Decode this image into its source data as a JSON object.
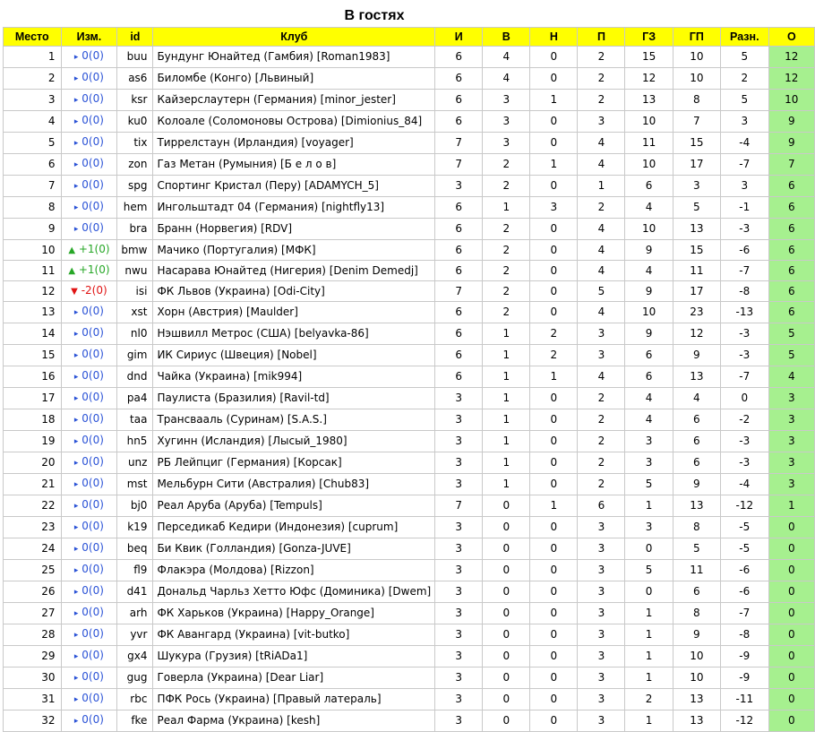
{
  "title": "В гостях",
  "headers": [
    "Место",
    "Изм.",
    "id",
    "Клуб",
    "И",
    "В",
    "Н",
    "П",
    "ГЗ",
    "ГП",
    "Разн.",
    "О"
  ],
  "colors": {
    "header_bg": "#ffff00",
    "points_bg": "#a6f08f",
    "same": "#2a52d6",
    "up": "#27a727",
    "down": "#e01414"
  },
  "rows": [
    {
      "place": "1",
      "dir": "same",
      "change": "0(0)",
      "id": "buu",
      "club": "Бундунг Юнайтед (Гамбия) [Roman1983]",
      "i": "6",
      "v": "4",
      "n": "0",
      "p": "2",
      "gz": "15",
      "gp": "10",
      "diff": "5",
      "o": "12"
    },
    {
      "place": "2",
      "dir": "same",
      "change": "0(0)",
      "id": "as6",
      "club": "Биломбе (Конго) [Львиный]",
      "i": "6",
      "v": "4",
      "n": "0",
      "p": "2",
      "gz": "12",
      "gp": "10",
      "diff": "2",
      "o": "12"
    },
    {
      "place": "3",
      "dir": "same",
      "change": "0(0)",
      "id": "ksr",
      "club": "Кайзерслаутерн (Германия) [minor_jester]",
      "i": "6",
      "v": "3",
      "n": "1",
      "p": "2",
      "gz": "13",
      "gp": "8",
      "diff": "5",
      "o": "10"
    },
    {
      "place": "4",
      "dir": "same",
      "change": "0(0)",
      "id": "ku0",
      "club": "Колоале (Соломоновы Острова) [Dimionius_84]",
      "i": "6",
      "v": "3",
      "n": "0",
      "p": "3",
      "gz": "10",
      "gp": "7",
      "diff": "3",
      "o": "9"
    },
    {
      "place": "5",
      "dir": "same",
      "change": "0(0)",
      "id": "tix",
      "club": "Тиррелстаун (Ирландия) [voyager]",
      "i": "7",
      "v": "3",
      "n": "0",
      "p": "4",
      "gz": "11",
      "gp": "15",
      "diff": "-4",
      "o": "9"
    },
    {
      "place": "6",
      "dir": "same",
      "change": "0(0)",
      "id": "zon",
      "club": "Газ Метан (Румыния) [Б е л о в]",
      "i": "7",
      "v": "2",
      "n": "1",
      "p": "4",
      "gz": "10",
      "gp": "17",
      "diff": "-7",
      "o": "7"
    },
    {
      "place": "7",
      "dir": "same",
      "change": "0(0)",
      "id": "spg",
      "club": "Спортинг Кристал (Перу) [ADAMYCH_5]",
      "i": "3",
      "v": "2",
      "n": "0",
      "p": "1",
      "gz": "6",
      "gp": "3",
      "diff": "3",
      "o": "6"
    },
    {
      "place": "8",
      "dir": "same",
      "change": "0(0)",
      "id": "hem",
      "club": "Ингольштадт 04 (Германия) [nightfly13]",
      "i": "6",
      "v": "1",
      "n": "3",
      "p": "2",
      "gz": "4",
      "gp": "5",
      "diff": "-1",
      "o": "6"
    },
    {
      "place": "9",
      "dir": "same",
      "change": "0(0)",
      "id": "bra",
      "club": "Бранн (Норвегия) [RDV]",
      "i": "6",
      "v": "2",
      "n": "0",
      "p": "4",
      "gz": "10",
      "gp": "13",
      "diff": "-3",
      "o": "6"
    },
    {
      "place": "10",
      "dir": "up",
      "change": "+1(0)",
      "id": "bmw",
      "club": "Мачико (Португалия) [МФК]",
      "i": "6",
      "v": "2",
      "n": "0",
      "p": "4",
      "gz": "9",
      "gp": "15",
      "diff": "-6",
      "o": "6"
    },
    {
      "place": "11",
      "dir": "up",
      "change": "+1(0)",
      "id": "nwu",
      "club": "Насарава Юнайтед (Нигерия) [Denim Demedj]",
      "i": "6",
      "v": "2",
      "n": "0",
      "p": "4",
      "gz": "4",
      "gp": "11",
      "diff": "-7",
      "o": "6"
    },
    {
      "place": "12",
      "dir": "down",
      "change": "-2(0)",
      "id": "isi",
      "club": "ФК Львов (Украина) [Odi-City]",
      "i": "7",
      "v": "2",
      "n": "0",
      "p": "5",
      "gz": "9",
      "gp": "17",
      "diff": "-8",
      "o": "6"
    },
    {
      "place": "13",
      "dir": "same",
      "change": "0(0)",
      "id": "xst",
      "club": "Хорн (Австрия) [Maulder]",
      "i": "6",
      "v": "2",
      "n": "0",
      "p": "4",
      "gz": "10",
      "gp": "23",
      "diff": "-13",
      "o": "6"
    },
    {
      "place": "14",
      "dir": "same",
      "change": "0(0)",
      "id": "nl0",
      "club": "Нэшвилл Метрос (США) [belyavka-86]",
      "i": "6",
      "v": "1",
      "n": "2",
      "p": "3",
      "gz": "9",
      "gp": "12",
      "diff": "-3",
      "o": "5"
    },
    {
      "place": "15",
      "dir": "same",
      "change": "0(0)",
      "id": "gim",
      "club": "ИК Сириус (Швеция) [Nobel]",
      "i": "6",
      "v": "1",
      "n": "2",
      "p": "3",
      "gz": "6",
      "gp": "9",
      "diff": "-3",
      "o": "5"
    },
    {
      "place": "16",
      "dir": "same",
      "change": "0(0)",
      "id": "dnd",
      "club": "Чайка (Украина) [mik994]",
      "i": "6",
      "v": "1",
      "n": "1",
      "p": "4",
      "gz": "6",
      "gp": "13",
      "diff": "-7",
      "o": "4"
    },
    {
      "place": "17",
      "dir": "same",
      "change": "0(0)",
      "id": "pa4",
      "club": "Паулиста (Бразилия) [Ravil-td]",
      "i": "3",
      "v": "1",
      "n": "0",
      "p": "2",
      "gz": "4",
      "gp": "4",
      "diff": "0",
      "o": "3"
    },
    {
      "place": "18",
      "dir": "same",
      "change": "0(0)",
      "id": "taa",
      "club": "Трансвааль (Суринам) [S.A.S.]",
      "i": "3",
      "v": "1",
      "n": "0",
      "p": "2",
      "gz": "4",
      "gp": "6",
      "diff": "-2",
      "o": "3"
    },
    {
      "place": "19",
      "dir": "same",
      "change": "0(0)",
      "id": "hn5",
      "club": "Хугинн (Исландия) [Лысый_1980]",
      "i": "3",
      "v": "1",
      "n": "0",
      "p": "2",
      "gz": "3",
      "gp": "6",
      "diff": "-3",
      "o": "3"
    },
    {
      "place": "20",
      "dir": "same",
      "change": "0(0)",
      "id": "unz",
      "club": "РБ Лейпциг (Германия) [Корсак]",
      "i": "3",
      "v": "1",
      "n": "0",
      "p": "2",
      "gz": "3",
      "gp": "6",
      "diff": "-3",
      "o": "3"
    },
    {
      "place": "21",
      "dir": "same",
      "change": "0(0)",
      "id": "mst",
      "club": "Мельбурн Сити (Австралия) [Chub83]",
      "i": "3",
      "v": "1",
      "n": "0",
      "p": "2",
      "gz": "5",
      "gp": "9",
      "diff": "-4",
      "o": "3"
    },
    {
      "place": "22",
      "dir": "same",
      "change": "0(0)",
      "id": "bj0",
      "club": "Реал Аруба (Аруба) [Tempuls]",
      "i": "7",
      "v": "0",
      "n": "1",
      "p": "6",
      "gz": "1",
      "gp": "13",
      "diff": "-12",
      "o": "1"
    },
    {
      "place": "23",
      "dir": "same",
      "change": "0(0)",
      "id": "k19",
      "club": "Перседикаб Кедири (Индонезия) [cuprum]",
      "i": "3",
      "v": "0",
      "n": "0",
      "p": "3",
      "gz": "3",
      "gp": "8",
      "diff": "-5",
      "o": "0"
    },
    {
      "place": "24",
      "dir": "same",
      "change": "0(0)",
      "id": "beq",
      "club": "Би Квик (Голландия) [Gonza-JUVE]",
      "i": "3",
      "v": "0",
      "n": "0",
      "p": "3",
      "gz": "0",
      "gp": "5",
      "diff": "-5",
      "o": "0"
    },
    {
      "place": "25",
      "dir": "same",
      "change": "0(0)",
      "id": "fl9",
      "club": "Флакэра (Молдова) [Rizzon]",
      "i": "3",
      "v": "0",
      "n": "0",
      "p": "3",
      "gz": "5",
      "gp": "11",
      "diff": "-6",
      "o": "0"
    },
    {
      "place": "26",
      "dir": "same",
      "change": "0(0)",
      "id": "d41",
      "club": "Дональд Чарльз Хетто Юфс (Доминика) [Dwem]",
      "i": "3",
      "v": "0",
      "n": "0",
      "p": "3",
      "gz": "0",
      "gp": "6",
      "diff": "-6",
      "o": "0"
    },
    {
      "place": "27",
      "dir": "same",
      "change": "0(0)",
      "id": "arh",
      "club": "ФК Харьков (Украина) [Happy_Orange]",
      "i": "3",
      "v": "0",
      "n": "0",
      "p": "3",
      "gz": "1",
      "gp": "8",
      "diff": "-7",
      "o": "0"
    },
    {
      "place": "28",
      "dir": "same",
      "change": "0(0)",
      "id": "yvr",
      "club": "ФК Авангард (Украина) [vit-butko]",
      "i": "3",
      "v": "0",
      "n": "0",
      "p": "3",
      "gz": "1",
      "gp": "9",
      "diff": "-8",
      "o": "0"
    },
    {
      "place": "29",
      "dir": "same",
      "change": "0(0)",
      "id": "gx4",
      "club": "Шукура (Грузия) [tRiADa1]",
      "i": "3",
      "v": "0",
      "n": "0",
      "p": "3",
      "gz": "1",
      "gp": "10",
      "diff": "-9",
      "o": "0"
    },
    {
      "place": "30",
      "dir": "same",
      "change": "0(0)",
      "id": "gug",
      "club": "Говерла (Украина) [Dear Liar]",
      "i": "3",
      "v": "0",
      "n": "0",
      "p": "3",
      "gz": "1",
      "gp": "10",
      "diff": "-9",
      "o": "0"
    },
    {
      "place": "31",
      "dir": "same",
      "change": "0(0)",
      "id": "rbc",
      "club": "ПФК Рось (Украина) [Правый латераль]",
      "i": "3",
      "v": "0",
      "n": "0",
      "p": "3",
      "gz": "2",
      "gp": "13",
      "diff": "-11",
      "o": "0"
    },
    {
      "place": "32",
      "dir": "same",
      "change": "0(0)",
      "id": "fke",
      "club": "Реал Фарма (Украина) [kesh]",
      "i": "3",
      "v": "0",
      "n": "0",
      "p": "3",
      "gz": "1",
      "gp": "13",
      "diff": "-12",
      "o": "0"
    }
  ]
}
